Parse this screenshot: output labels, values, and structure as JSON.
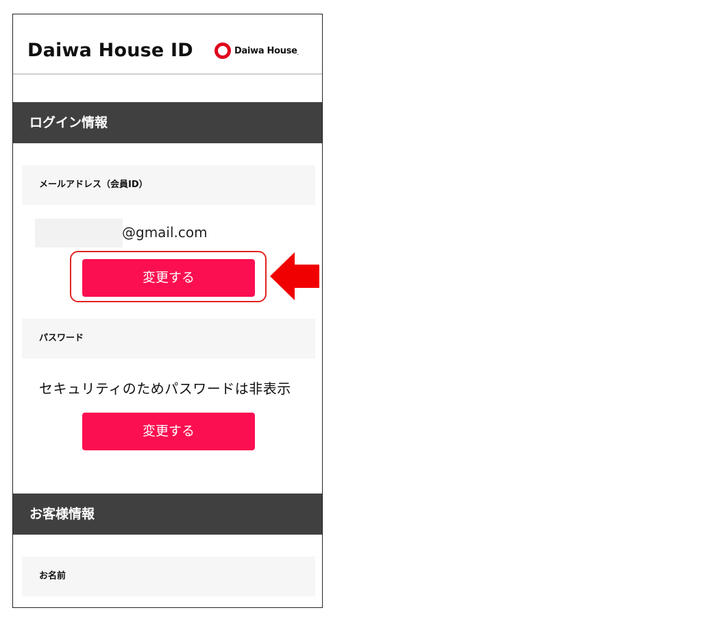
{
  "header": {
    "title": "Daiwa House ID",
    "brand": "Daiwa House",
    "brand_mark": "."
  },
  "login_section": {
    "title": "ログイン情報",
    "email_label": "メールアドレス（会員ID）",
    "email_domain": "@gmail.com",
    "email_change_button": "変更する",
    "password_label": "パスワード",
    "password_note": "セキュリティのためパスワードは非表示",
    "password_change_button": "変更する"
  },
  "customer_section": {
    "title": "お客様情報",
    "name_label": "お名前"
  },
  "colors": {
    "accent": "#fb0f50",
    "section_bar": "#404040",
    "annotation": "#e32222",
    "brand": "#e0001b"
  },
  "annotation": {
    "arrow_icon": "left-arrow-icon"
  }
}
